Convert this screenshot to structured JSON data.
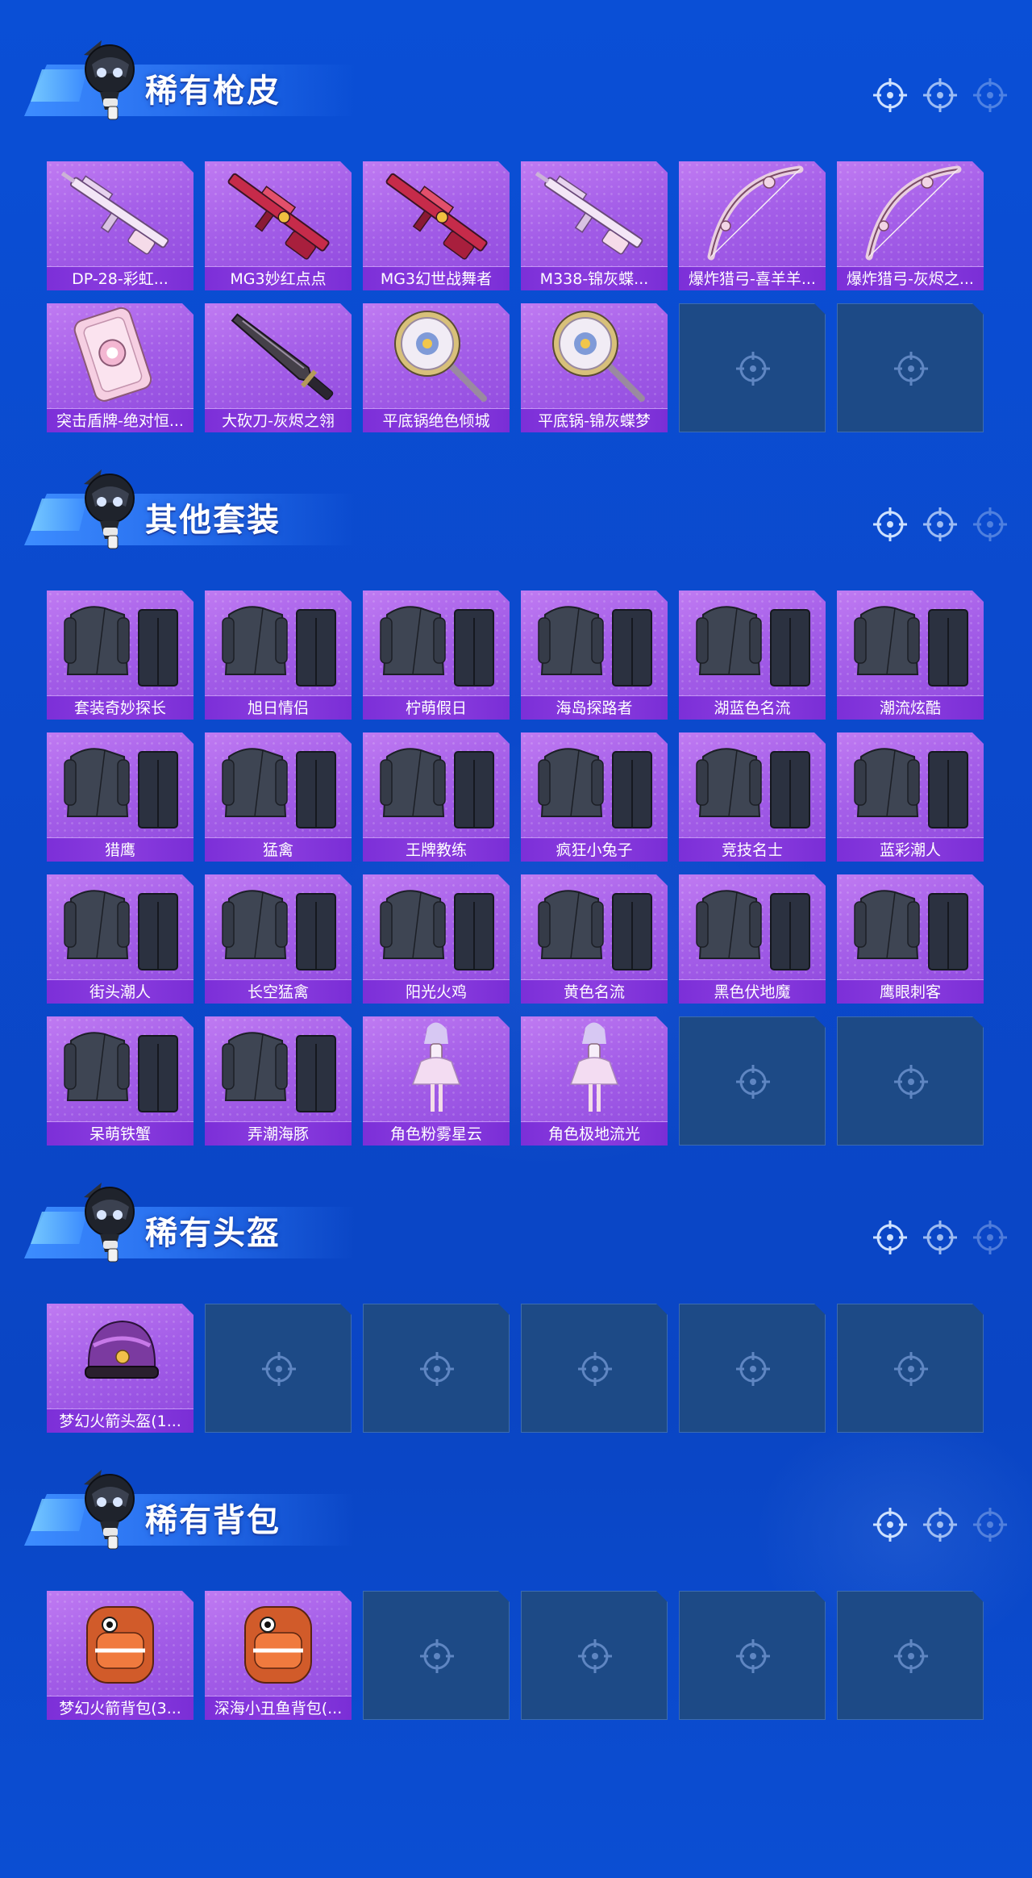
{
  "colors": {
    "background": "#0a4fd6",
    "card_purple": "#a45ee8",
    "card_label": "#7c2fd8",
    "empty_slot": "#1d4a86",
    "title_text": "#ffffff"
  },
  "sections": [
    {
      "id": "rare-gun-skins",
      "title": "稀有枪皮",
      "items": [
        {
          "name": "DP-28-彩虹...",
          "icon": "rifle-icon"
        },
        {
          "name": "MG3妙红点点",
          "icon": "machine-gun-icon"
        },
        {
          "name": "MG3幻世战舞者",
          "icon": "machine-gun-icon"
        },
        {
          "name": "M338-锦灰蝶...",
          "icon": "rifle-icon"
        },
        {
          "name": "爆炸猎弓-喜羊羊...",
          "icon": "bow-icon"
        },
        {
          "name": "爆炸猎弓-灰烬之...",
          "icon": "bow-icon"
        },
        {
          "name": "突击盾牌-绝对恒...",
          "icon": "shield-icon"
        },
        {
          "name": "大砍刀-灰烬之翎",
          "icon": "machete-icon"
        },
        {
          "name": "平底锅绝色倾城",
          "icon": "pan-icon"
        },
        {
          "name": "平底锅-锦灰蝶梦",
          "icon": "pan-icon"
        }
      ],
      "empty_slots": 2
    },
    {
      "id": "other-outfits",
      "title": "其他套装",
      "items": [
        {
          "name": "套装奇妙探长",
          "icon": "outfit-icon"
        },
        {
          "name": "旭日情侣",
          "icon": "outfit-icon"
        },
        {
          "name": "柠萌假日",
          "icon": "outfit-icon"
        },
        {
          "name": "海岛探路者",
          "icon": "outfit-icon"
        },
        {
          "name": "湖蓝色名流",
          "icon": "outfit-icon"
        },
        {
          "name": "潮流炫酷",
          "icon": "outfit-icon"
        },
        {
          "name": "猎鹰",
          "icon": "outfit-icon"
        },
        {
          "name": "猛禽",
          "icon": "outfit-icon"
        },
        {
          "name": "王牌教练",
          "icon": "outfit-icon"
        },
        {
          "name": "疯狂小兔子",
          "icon": "outfit-icon"
        },
        {
          "name": "竞技名士",
          "icon": "outfit-icon"
        },
        {
          "name": "蓝彩潮人",
          "icon": "outfit-icon"
        },
        {
          "name": "街头潮人",
          "icon": "outfit-icon"
        },
        {
          "name": "长空猛禽",
          "icon": "outfit-icon"
        },
        {
          "name": "阳光火鸡",
          "icon": "outfit-icon"
        },
        {
          "name": "黄色名流",
          "icon": "outfit-icon"
        },
        {
          "name": "黑色伏地魔",
          "icon": "outfit-icon"
        },
        {
          "name": "鹰眼刺客",
          "icon": "outfit-icon"
        },
        {
          "name": "呆萌铁蟹",
          "icon": "outfit-icon"
        },
        {
          "name": "弄潮海豚",
          "icon": "outfit-icon"
        },
        {
          "name": "角色粉雾星云",
          "icon": "character-icon"
        },
        {
          "name": "角色极地流光",
          "icon": "character-icon"
        }
      ],
      "empty_slots": 2
    },
    {
      "id": "rare-helmets",
      "title": "稀有头盔",
      "items": [
        {
          "name": "梦幻火箭头盔(1...",
          "icon": "helmet-icon"
        }
      ],
      "empty_slots": 5
    },
    {
      "id": "rare-backpacks",
      "title": "稀有背包",
      "items": [
        {
          "name": "梦幻火箭背包(3...",
          "icon": "backpack-icon"
        },
        {
          "name": "深海小丑鱼背包(...",
          "icon": "backpack-icon"
        }
      ],
      "empty_slots": 4
    }
  ]
}
